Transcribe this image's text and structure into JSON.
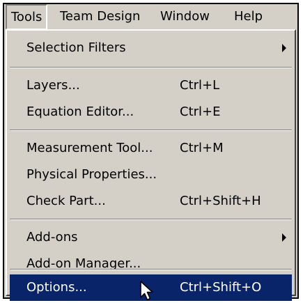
{
  "menubar": {
    "items": [
      {
        "label": "Tools"
      },
      {
        "label": "Team Design"
      },
      {
        "label": "Window"
      },
      {
        "label": "Help"
      }
    ]
  },
  "menu": {
    "items": [
      {
        "label": "Selection Filters",
        "shortcut": "",
        "submenu": true
      },
      {
        "label": "Layers...",
        "shortcut": "Ctrl+L"
      },
      {
        "label": "Equation Editor...",
        "shortcut": "Ctrl+E"
      },
      {
        "label": "Measurement Tool...",
        "shortcut": "Ctrl+M"
      },
      {
        "label": "Physical Properties...",
        "shortcut": ""
      },
      {
        "label": "Check Part...",
        "shortcut": "Ctrl+Shift+H"
      },
      {
        "label": "Add-ons",
        "shortcut": "",
        "submenu": true
      },
      {
        "label": "Add-on Manager...",
        "shortcut": ""
      },
      {
        "label": "Options...",
        "shortcut": "Ctrl+Shift+O",
        "highlighted": true
      }
    ]
  },
  "colors": {
    "menu_face": "#d4d0c8",
    "highlight": "#0a246a",
    "highlight_text": "#ffffff"
  },
  "icons": {
    "submenu_arrow": "triangle-right-icon",
    "pointer": "mouse-cursor-icon"
  }
}
